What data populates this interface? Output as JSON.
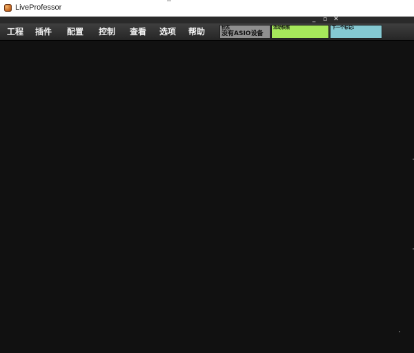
{
  "window": {
    "title": "LiveProfessor",
    "app_icon": "liveprofessor-app-icon"
  },
  "controls": {
    "minimize": "_",
    "maximize": "▫",
    "close": "✕"
  },
  "menu": {
    "items": [
      {
        "label": "工程"
      },
      {
        "label": "插件"
      },
      {
        "label": "配置"
      },
      {
        "label": "控制"
      },
      {
        "label": "查看"
      },
      {
        "label": "选项"
      },
      {
        "label": "帮助"
      }
    ]
  },
  "status": {
    "state": {
      "label": "状态",
      "value": "没有ASIO设备",
      "color": "#8f8f8f"
    },
    "active_snapshot": {
      "label": "活动快照",
      "value": "",
      "color": "#a6e85b"
    },
    "next_marker": {
      "label": "下一个标记:",
      "value": "",
      "color": "#85c9d2"
    }
  },
  "colors": {
    "background": "#111111",
    "menu_bar": "#2f2f2f"
  }
}
